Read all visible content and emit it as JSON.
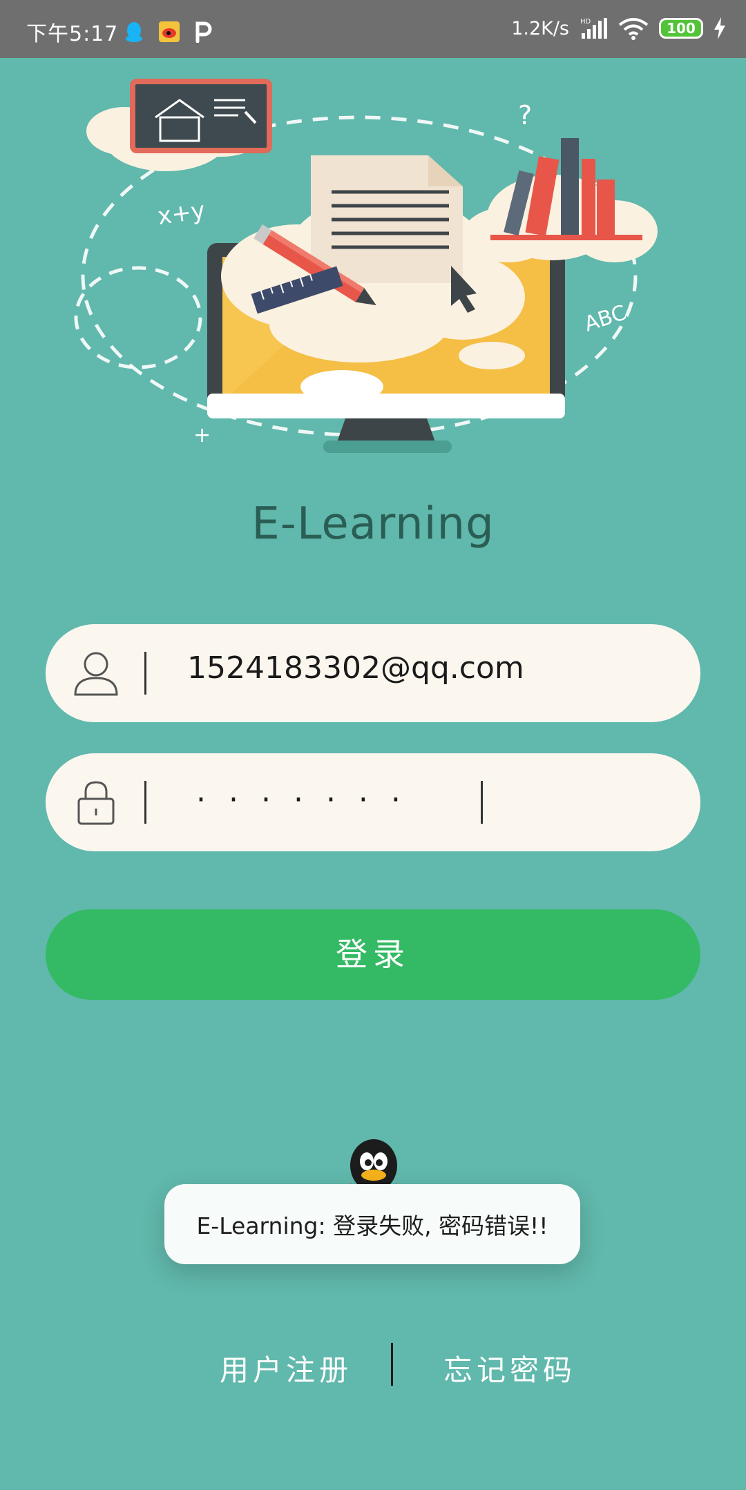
{
  "status_bar": {
    "time": "下午5:17",
    "network_speed": "1.2K/s",
    "battery": "100",
    "app_icons": [
      "qq-icon",
      "weibo-icon",
      "p-icon"
    ]
  },
  "app": {
    "title": "E-Learning"
  },
  "form": {
    "email_value": "1524183302@qq.com",
    "password_mask": "·······",
    "login_label": "登录"
  },
  "toast": {
    "message": "E-Learning: 登录失败, 密码错误!!"
  },
  "links": {
    "register": "用户注册",
    "forgot_password": "忘记密码"
  },
  "colors": {
    "background": "#61b8ac",
    "field_bg": "#fbf7ef",
    "login_button": "#34ba64",
    "title": "#2a5e55",
    "status_bar": "#6f6f6f"
  }
}
